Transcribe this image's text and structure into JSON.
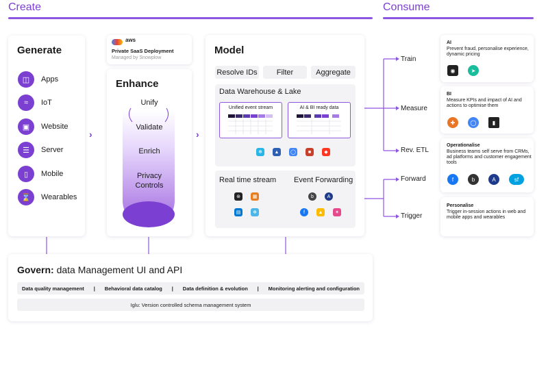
{
  "headers": {
    "create": "Create",
    "consume": "Consume"
  },
  "generate": {
    "title": "Generate",
    "items": [
      "Apps",
      "IoT",
      "Website",
      "Server",
      "Mobile",
      "Wearables"
    ]
  },
  "aws": {
    "badge": "aws",
    "title": "Private SaaS Deployment",
    "subtitle": "Managed by Snowplow"
  },
  "enhance": {
    "title": "Enhance",
    "steps": [
      "Unify",
      "Validate",
      "Enrich",
      "Privacy",
      "Controls"
    ]
  },
  "model": {
    "title": "Model",
    "pills": [
      "Resolve IDs",
      "Filter",
      "Aggregate"
    ],
    "warehouse": "Data Warehouse & Lake",
    "unified": "Unified event stream",
    "ai_ready": "AI & BI ready data",
    "realtime": "Real time stream",
    "forwarding": "Event Forwarding"
  },
  "consume": {
    "labels": [
      "Train",
      "Measure",
      "Rev. ETL",
      "Forward",
      "Trigger"
    ],
    "cards": [
      {
        "title": "AI",
        "text": "Prevent fraud, personalise experience, dynamic pricing"
      },
      {
        "title": "BI",
        "text": "Measure KPIs and impact of AI and actions to optimise them"
      },
      {
        "title": "Operationalise",
        "text": "Business teams self serve from CRMs, ad platforms and customer engagement tools"
      },
      {
        "title": "Personalise",
        "text": "Trigger in-session actions in web and mobile apps and wearables"
      }
    ]
  },
  "govern": {
    "title_bold": "Govern:",
    "title_rest": " data Management UI and API",
    "tags": [
      "Data quality management",
      "|",
      "Behavioral data catalog",
      "|",
      "Data definition & evolution",
      "|",
      "Monitoring alerting and configuration"
    ],
    "iglu": "Iglu: Version controlled schema management system"
  },
  "colors": {
    "accent": "#7b3fd1",
    "line": "#8e55e0"
  }
}
